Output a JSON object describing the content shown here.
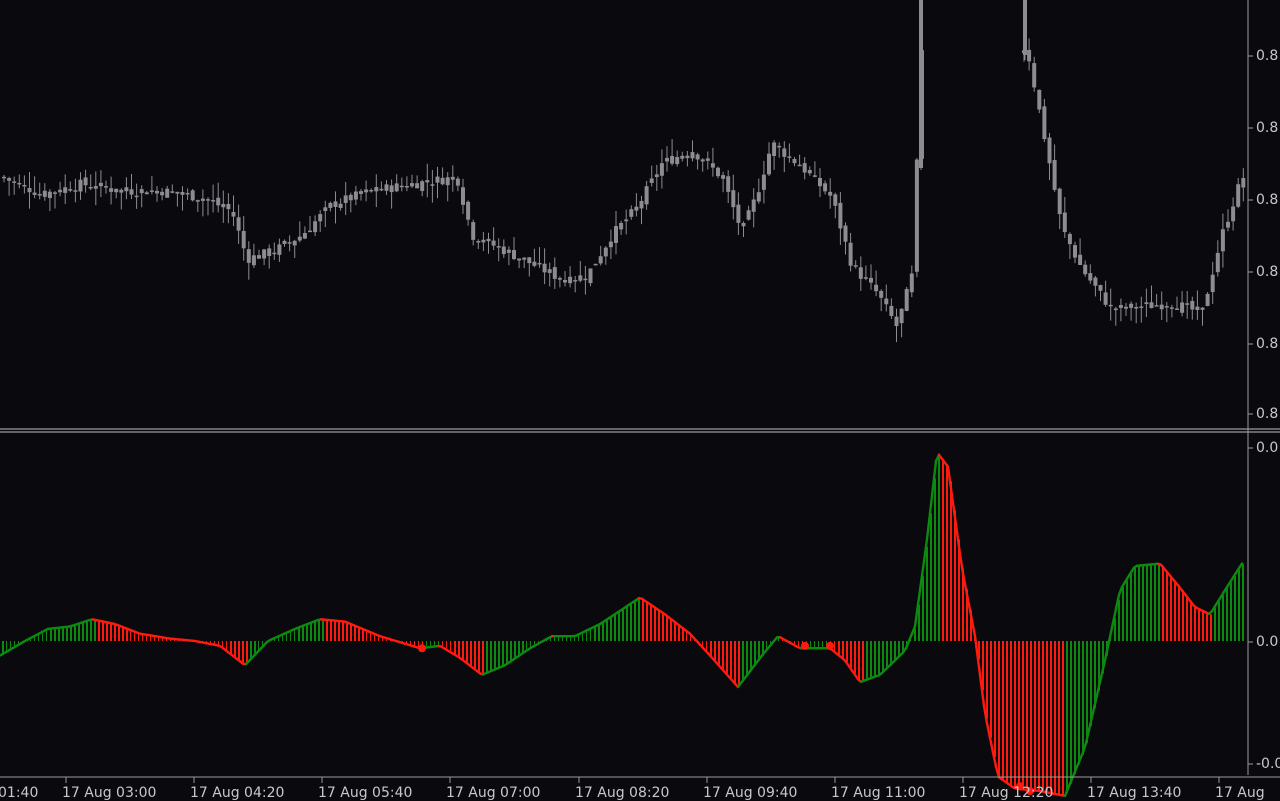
{
  "colors": {
    "background": "#0a090e",
    "candle": "#8c8c92",
    "separator": "#c0c0c0",
    "axis_text": "#c8c8c8",
    "bull": "#0c8a10",
    "bear": "#ff1a10"
  },
  "price_axis": {
    "labels": [
      "0.8",
      "0.8",
      "0.8",
      "0.8",
      "0.8",
      "0.8",
      "0.8",
      "0.8"
    ]
  },
  "indicator_axis": {
    "labels": [
      "0.0",
      "0.0",
      "-0.0"
    ]
  },
  "time_axis": {
    "labels": [
      "01:40",
      "17 Aug 03:00",
      "17 Aug 04:20",
      "17 Aug 05:40",
      "17 Aug 07:00",
      "17 Aug 08:20",
      "17 Aug 09:40",
      "17 Aug 11:00",
      "17 Aug 12:20",
      "17 Aug 13:40",
      "17 Aug"
    ]
  },
  "chart_data": {
    "type": "bar",
    "panes": [
      "price candlesticks",
      "oscillator histogram"
    ],
    "indicator_keypoints_relative": [
      [
        0,
        -0.06
      ],
      [
        25,
        0.0
      ],
      [
        48,
        0.05
      ],
      [
        70,
        0.06
      ],
      [
        92,
        0.09
      ],
      [
        115,
        0.07
      ],
      [
        140,
        0.03
      ],
      [
        170,
        0.01
      ],
      [
        195,
        0.0
      ],
      [
        220,
        -0.02
      ],
      [
        245,
        -0.1
      ],
      [
        268,
        0.0
      ],
      [
        295,
        0.05
      ],
      [
        320,
        0.09
      ],
      [
        345,
        0.08
      ],
      [
        380,
        0.02
      ],
      [
        420,
        -0.03
      ],
      [
        440,
        -0.02
      ],
      [
        460,
        -0.07
      ],
      [
        482,
        -0.14
      ],
      [
        505,
        -0.1
      ],
      [
        530,
        -0.03
      ],
      [
        552,
        0.02
      ],
      [
        575,
        0.02
      ],
      [
        600,
        0.07
      ],
      [
        622,
        0.13
      ],
      [
        640,
        0.18
      ],
      [
        665,
        0.11
      ],
      [
        690,
        0.03
      ],
      [
        710,
        -0.06
      ],
      [
        738,
        -0.19
      ],
      [
        762,
        -0.06
      ],
      [
        778,
        0.02
      ],
      [
        800,
        -0.03
      ],
      [
        830,
        -0.03
      ],
      [
        845,
        -0.08
      ],
      [
        860,
        -0.17
      ],
      [
        880,
        -0.14
      ],
      [
        905,
        -0.04
      ],
      [
        915,
        0.06
      ],
      [
        927,
        0.42
      ],
      [
        937,
        0.78
      ],
      [
        948,
        0.72
      ],
      [
        962,
        0.3
      ],
      [
        975,
        0.02
      ],
      [
        985,
        -0.3
      ],
      [
        998,
        -0.56
      ],
      [
        1015,
        -0.61
      ],
      [
        1040,
        -0.62
      ],
      [
        1065,
        -0.64
      ],
      [
        1085,
        -0.44
      ],
      [
        1105,
        -0.08
      ],
      [
        1120,
        0.21
      ],
      [
        1135,
        0.31
      ],
      [
        1160,
        0.32
      ],
      [
        1180,
        0.22
      ],
      [
        1195,
        0.14
      ],
      [
        1210,
        0.11
      ],
      [
        1225,
        0.21
      ],
      [
        1242,
        0.32
      ]
    ],
    "candle_closes_relative": [
      [
        0,
        0.62
      ],
      [
        40,
        0.57
      ],
      [
        80,
        0.6
      ],
      [
        120,
        0.58
      ],
      [
        160,
        0.58
      ],
      [
        200,
        0.56
      ],
      [
        230,
        0.52
      ],
      [
        245,
        0.38
      ],
      [
        270,
        0.4
      ],
      [
        300,
        0.45
      ],
      [
        330,
        0.54
      ],
      [
        370,
        0.58
      ],
      [
        410,
        0.6
      ],
      [
        455,
        0.62
      ],
      [
        470,
        0.45
      ],
      [
        520,
        0.38
      ],
      [
        560,
        0.32
      ],
      [
        585,
        0.33
      ],
      [
        610,
        0.45
      ],
      [
        635,
        0.53
      ],
      [
        660,
        0.66
      ],
      [
        690,
        0.7
      ],
      [
        720,
        0.62
      ],
      [
        740,
        0.46
      ],
      [
        755,
        0.57
      ],
      [
        770,
        0.72
      ],
      [
        800,
        0.65
      ],
      [
        830,
        0.56
      ],
      [
        850,
        0.36
      ],
      [
        875,
        0.28
      ],
      [
        895,
        0.18
      ],
      [
        910,
        0.33
      ],
      [
        920,
        1.0
      ],
      [
        1025,
        1.0
      ],
      [
        1045,
        0.7
      ],
      [
        1060,
        0.47
      ],
      [
        1080,
        0.35
      ],
      [
        1110,
        0.23
      ],
      [
        1140,
        0.24
      ],
      [
        1170,
        0.25
      ],
      [
        1200,
        0.22
      ],
      [
        1220,
        0.45
      ],
      [
        1240,
        0.62
      ]
    ]
  }
}
